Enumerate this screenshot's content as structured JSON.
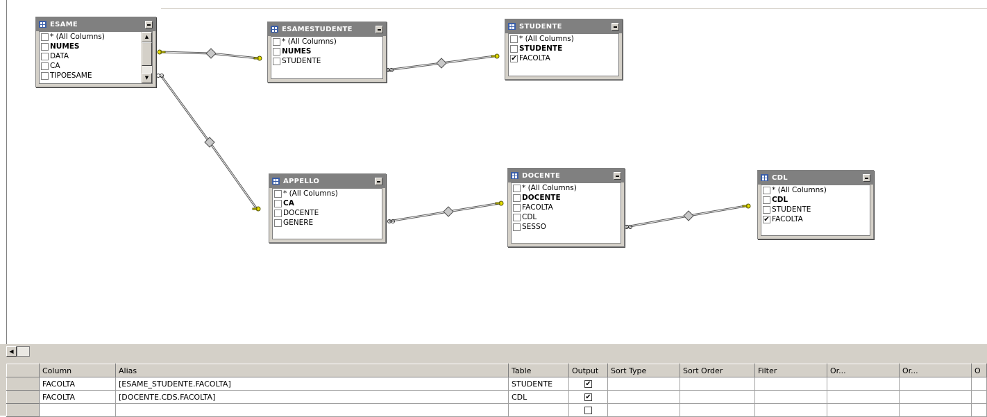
{
  "tables": {
    "esame": {
      "title": "ESAME",
      "rows": [
        {
          "label": "* (All Columns)",
          "checked": false,
          "bold": false
        },
        {
          "label": "NUMES",
          "checked": false,
          "bold": true
        },
        {
          "label": "DATA",
          "checked": false,
          "bold": false
        },
        {
          "label": "CA",
          "checked": false,
          "bold": false
        },
        {
          "label": "TIPOESAME",
          "checked": false,
          "bold": false
        }
      ]
    },
    "esamestudente": {
      "title": "ESAMESTUDENTE",
      "rows": [
        {
          "label": "* (All Columns)",
          "checked": false,
          "bold": false
        },
        {
          "label": "NUMES",
          "checked": false,
          "bold": true
        },
        {
          "label": "STUDENTE",
          "checked": false,
          "bold": false
        }
      ]
    },
    "studente": {
      "title": "STUDENTE",
      "rows": [
        {
          "label": "* (All Columns)",
          "checked": false,
          "bold": false
        },
        {
          "label": "STUDENTE",
          "checked": false,
          "bold": true
        },
        {
          "label": "FACOLTA",
          "checked": true,
          "bold": false
        }
      ]
    },
    "appello": {
      "title": "APPELLO",
      "rows": [
        {
          "label": "* (All Columns)",
          "checked": false,
          "bold": false
        },
        {
          "label": "CA",
          "checked": false,
          "bold": true
        },
        {
          "label": "DOCENTE",
          "checked": false,
          "bold": false
        },
        {
          "label": "GENERE",
          "checked": false,
          "bold": false
        }
      ]
    },
    "docente": {
      "title": "DOCENTE",
      "rows": [
        {
          "label": "* (All Columns)",
          "checked": false,
          "bold": false
        },
        {
          "label": "DOCENTE",
          "checked": false,
          "bold": true
        },
        {
          "label": "FACOLTA",
          "checked": false,
          "bold": false
        },
        {
          "label": "CDL",
          "checked": false,
          "bold": false
        },
        {
          "label": "SESSO",
          "checked": false,
          "bold": false
        }
      ]
    },
    "cdl": {
      "title": "CDL",
      "rows": [
        {
          "label": "* (All Columns)",
          "checked": false,
          "bold": false
        },
        {
          "label": "CDL",
          "checked": false,
          "bold": true
        },
        {
          "label": "STUDENTE",
          "checked": false,
          "bold": false
        },
        {
          "label": "FACOLTA",
          "checked": true,
          "bold": false
        }
      ]
    }
  },
  "grid": {
    "headers": [
      "",
      "Column",
      "Alias",
      "Table",
      "Output",
      "Sort Type",
      "Sort Order",
      "Filter",
      "Or...",
      "Or...",
      "O"
    ],
    "rows": [
      {
        "column": "FACOLTA",
        "alias": "[ESAME_STUDENTE.FACOLTA]",
        "table": "STUDENTE",
        "output": true
      },
      {
        "column": "FACOLTA",
        "alias": "[DOCENTE.CDS.FACOLTA]",
        "table": "CDL",
        "output": true
      },
      {
        "column": "",
        "alias": "",
        "table": "",
        "output": false
      }
    ]
  },
  "check_glyph": "✔",
  "colors": {
    "title_bar": "#808080",
    "panel": "#d4d0c8",
    "key_icon": "#e8e000"
  }
}
